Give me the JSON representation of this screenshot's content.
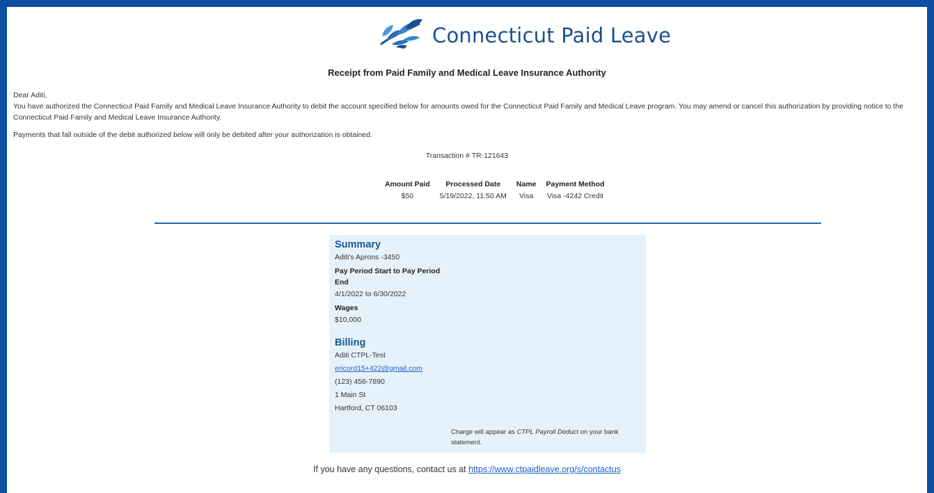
{
  "brand": {
    "name": "Connecticut Paid Leave",
    "accent_color": "#1d4f8f",
    "logo_icon": "leaves-logo-icon"
  },
  "receipt": {
    "title": "Receipt from Paid Family and Medical Leave Insurance Authority",
    "greeting": "Dear Aditi,",
    "paragraph1": "You have authorized the Connecticut Paid Family and Medical Leave Insurance Authority to debit the account specified below for amounts owed for the Connecticut Paid Family and Medical Leave program. You may amend or cancel this authorization by providing notice to the Connecticut Paid Family and Medical Leave Insurance Authority.",
    "paragraph2": "Payments that fall outside of the debit authorized below will only be debited after your authorization is obtained.",
    "transaction": "Transaction # TR-121643"
  },
  "payment_table": {
    "headers": [
      "Amount Paid",
      "Processed Date",
      "Name",
      "Payment Method"
    ],
    "row": [
      "$50",
      "5/19/2022, 11:50 AM",
      "Visa",
      "Visa -4242 Credit"
    ]
  },
  "summary": {
    "heading": "Summary",
    "employer": "Aditi's Aprons -3450",
    "period_label": "Pay Period Start to Pay Period End",
    "period_value": "4/1/2022 to 6/30/2022",
    "wages_label": "Wages",
    "wages_value": "$10,000"
  },
  "billing": {
    "heading": "Billing",
    "name": "Aditi CTPL-Test",
    "email": "ericord15+422@gmail.com",
    "phone": "(123) 456-7890",
    "street": "1 Main St",
    "city": "Hartford, CT 06103"
  },
  "charge_note": {
    "prefix": "Charge will appear as ",
    "descriptor": "CTPL Payroll Deduct",
    "suffix": " on your bank statement."
  },
  "footer": {
    "text": "If you have any questions, contact us at ",
    "link": "https://www.ctpaidleave.org/s/contactus"
  }
}
